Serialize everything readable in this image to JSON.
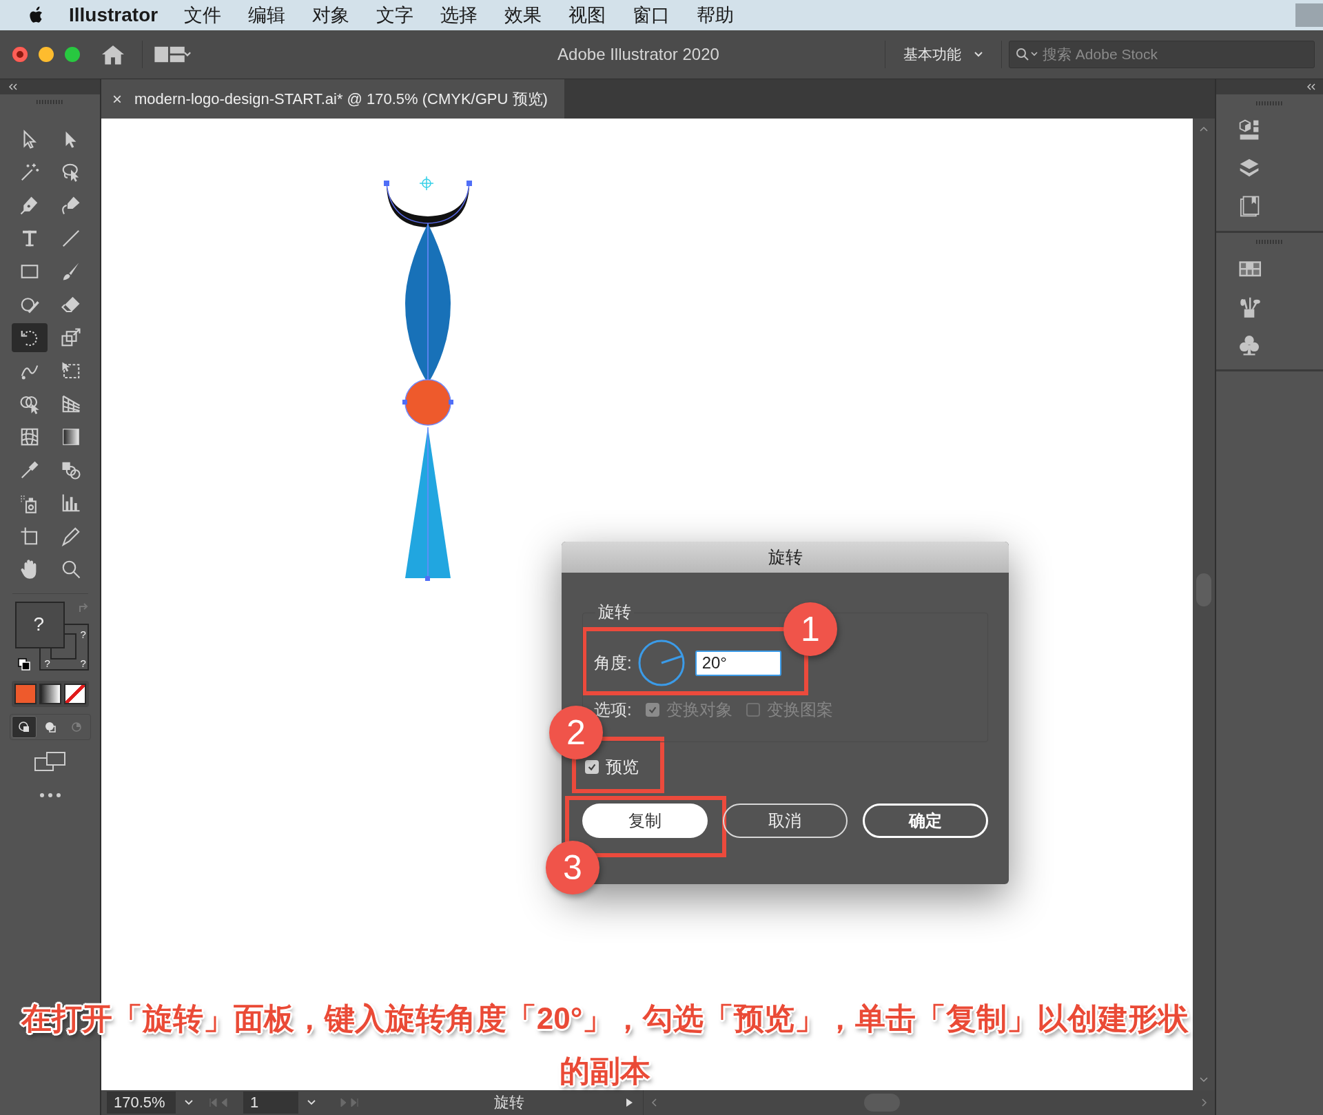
{
  "menu_bar": {
    "app_name": "Illustrator",
    "items": [
      "文件",
      "编辑",
      "对象",
      "文字",
      "选择",
      "效果",
      "视图",
      "窗口",
      "帮助"
    ]
  },
  "title_bar": {
    "title": "Adobe Illustrator 2020",
    "workspace": "基本功能",
    "search": {
      "placeholder": "搜索 Adobe Stock"
    }
  },
  "document_tab": {
    "close": "×",
    "title": "modern-logo-design-START.ai* @ 170.5% (CMYK/GPU 预览)"
  },
  "toolbar": {
    "tools": [
      {
        "kind": "selection",
        "selected": false
      },
      {
        "kind": "direct",
        "selected": false
      },
      {
        "kind": "wand",
        "selected": false
      },
      {
        "kind": "lasso",
        "selected": false
      },
      {
        "kind": "pen",
        "selected": false
      },
      {
        "kind": "curvature",
        "selected": false
      },
      {
        "kind": "type",
        "selected": false
      },
      {
        "kind": "line",
        "selected": false
      },
      {
        "kind": "rectangle",
        "selected": false
      },
      {
        "kind": "brush",
        "selected": false
      },
      {
        "kind": "shaper",
        "selected": false
      },
      {
        "kind": "eraser",
        "selected": false
      },
      {
        "kind": "rotate",
        "selected": true
      },
      {
        "kind": "scale",
        "selected": false
      },
      {
        "kind": "warp",
        "selected": false
      },
      {
        "kind": "transform",
        "selected": false
      },
      {
        "kind": "builder",
        "selected": false
      },
      {
        "kind": "perspective",
        "selected": false
      },
      {
        "kind": "mesh",
        "selected": false
      },
      {
        "kind": "gradient",
        "selected": false
      },
      {
        "kind": "eyedropper",
        "selected": false
      },
      {
        "kind": "blend",
        "selected": false
      },
      {
        "kind": "sprayer",
        "selected": false
      },
      {
        "kind": "graph",
        "selected": false
      },
      {
        "kind": "artboard",
        "selected": false
      },
      {
        "kind": "knife",
        "selected": false
      },
      {
        "kind": "hand",
        "selected": false
      },
      {
        "kind": "zoom",
        "selected": false
      }
    ],
    "fill_label": "?",
    "stroke_labels": [
      "?",
      "?",
      "?"
    ],
    "draw_modes": [
      {
        "selected": true,
        "disabled": false
      },
      {
        "selected": false,
        "disabled": false
      },
      {
        "selected": false,
        "disabled": true
      }
    ]
  },
  "dialog": {
    "title": "旋转",
    "group_label": "旋转",
    "angle_label": "角度:",
    "angle_value": "20°",
    "options_label": "选项:",
    "options": [
      {
        "label": "变换对象",
        "checked": true,
        "disabled": true
      },
      {
        "label": "变换图案",
        "checked": false,
        "disabled": true
      }
    ],
    "preview": {
      "label": "预览",
      "checked": true
    },
    "buttons": [
      {
        "label": "复制",
        "kind": "primary"
      },
      {
        "label": "取消",
        "kind": "secondary"
      },
      {
        "label": "确定",
        "kind": "default"
      }
    ]
  },
  "callouts": [
    "1",
    "2",
    "3"
  ],
  "status_bar": {
    "zoom": "170.5%",
    "page": "1",
    "status": "旋转"
  },
  "caption": "在打开「旋转」面板，键入旋转角度「20°」，勾选「预览」，单击「复制」以创建形状的副本"
}
